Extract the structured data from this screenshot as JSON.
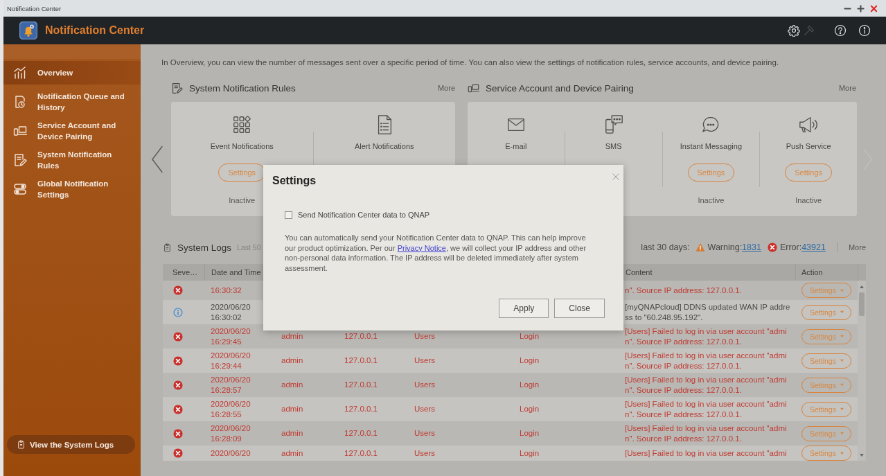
{
  "os_window": {
    "title": "Notification Center"
  },
  "app_header": {
    "title": "Notification Center",
    "toolbar": [
      {
        "disabled": false
      },
      {
        "disabled": true
      },
      {
        "disabled": false
      },
      {
        "disabled": false
      }
    ]
  },
  "sidebar": {
    "items": [
      {
        "label": "Overview",
        "selected": true
      },
      {
        "label": "Notification Queue and History",
        "selected": false
      },
      {
        "label": "Service Account and Device Pairing",
        "selected": false
      },
      {
        "label": "System Notification Rules",
        "selected": false
      },
      {
        "label": "Global Notification Settings",
        "selected": false
      }
    ],
    "footer_button": "View the System Logs"
  },
  "overview": {
    "intro": "In Overview, you can view the number of messages sent over a specific period of time. You can also view the settings of notification rules, service accounts, and device pairing.",
    "sections": [
      {
        "title": "System Notification Rules",
        "more": "More",
        "items": [
          {
            "label": "Event Notifications",
            "button": "Settings",
            "status": "Inactive"
          },
          {
            "label": "Alert Notifications"
          }
        ]
      },
      {
        "title": "Service Account and Device Pairing",
        "more": "More",
        "items": [
          {
            "label": "E-mail"
          },
          {
            "label": "SMS"
          },
          {
            "label": "Instant Messaging",
            "button": "Settings",
            "status": "Inactive"
          },
          {
            "label": "Push Service",
            "button": "Settings",
            "status": "Inactive"
          }
        ]
      }
    ]
  },
  "system_logs": {
    "title": "System Logs",
    "subtitle": "Last 50",
    "summary": "last 30 days:",
    "warning_label": "Warning:",
    "warning_count": "1831",
    "error_label": "Error:",
    "error_count": "43921",
    "more": "More",
    "columns": {
      "severity": "Seve…",
      "date_time": "Date and Time",
      "content": "Content",
      "action": "Action"
    },
    "rows": [
      {
        "kind": "error",
        "date_time": "16:30:32",
        "content": "n\". Source IP address: 127.0.0.1.",
        "action": "Settings"
      },
      {
        "kind": "info",
        "date_time": "2020/06/20 16:30:02",
        "content": "[myQNAPcloud] DDNS updated WAN IP address to \"60.248.95.192\".",
        "action": "Settings"
      },
      {
        "kind": "error",
        "date_time": "2020/06/20 16:29:45",
        "column_3": "admin",
        "column_4": "127.0.0.1",
        "column_5": "Users",
        "column_6": "Login",
        "content": "[Users] Failed to log in via user account \"admin\". Source IP address: 127.0.0.1.",
        "action": "Settings"
      },
      {
        "kind": "error",
        "date_time": "2020/06/20 16:29:44",
        "column_3": "admin",
        "column_4": "127.0.0.1",
        "column_5": "Users",
        "column_6": "Login",
        "content": "[Users] Failed to log in via user account \"admin\". Source IP address: 127.0.0.1.",
        "action": "Settings"
      },
      {
        "kind": "error",
        "date_time": "2020/06/20 16:28:57",
        "column_3": "admin",
        "column_4": "127.0.0.1",
        "column_5": "Users",
        "column_6": "Login",
        "content": "[Users] Failed to log in via user account \"admin\". Source IP address: 127.0.0.1.",
        "action": "Settings"
      },
      {
        "kind": "error",
        "date_time": "2020/06/20 16:28:55",
        "column_3": "admin",
        "column_4": "127.0.0.1",
        "column_5": "Users",
        "column_6": "Login",
        "content": "[Users] Failed to log in via user account \"admin\". Source IP address: 127.0.0.1.",
        "action": "Settings"
      },
      {
        "kind": "error",
        "date_time": "2020/06/20 16:28:09",
        "column_3": "admin",
        "column_4": "127.0.0.1",
        "column_5": "Users",
        "column_6": "Login",
        "content": "[Users] Failed to log in via user account \"admin\". Source IP address: 127.0.0.1.",
        "action": "Settings"
      },
      {
        "kind": "error",
        "date_time": "2020/06/20",
        "column_3": "admin",
        "column_4": "127.0.0.1",
        "column_5": "Users",
        "column_6": "Login",
        "content": "[Users] Failed to log in via user account \"admi",
        "action": "Settings"
      }
    ]
  },
  "dialog": {
    "title": "Settings",
    "checkbox": {
      "label": "Send Notification Center data to QNAP",
      "checked": false
    },
    "message": {
      "before": "You can automatically send your Notification Center data to QNAP. This can help improve our product optimization. Per our ",
      "link": "Privacy Notice",
      "after": ", we will collect your IP address and other non-personal data information. The IP address will be deleted immediately after system assessment."
    },
    "buttons": [
      "Apply",
      "Close"
    ]
  }
}
